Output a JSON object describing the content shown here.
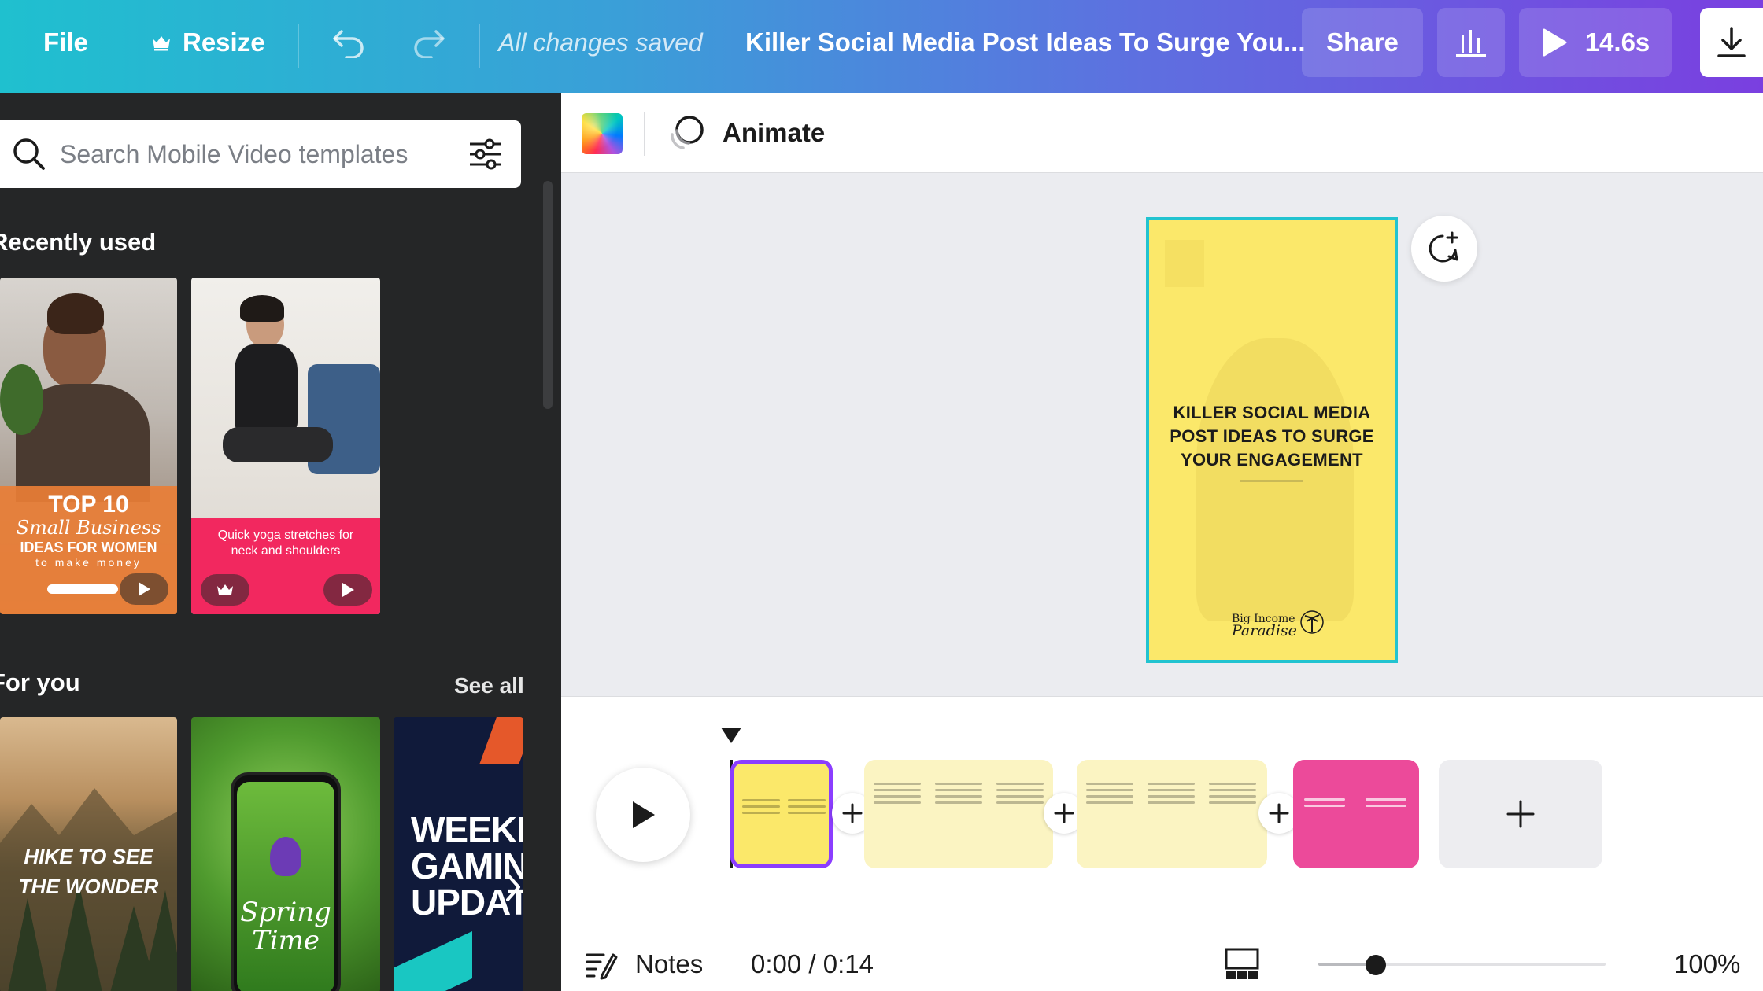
{
  "topbar": {
    "file_label": "File",
    "resize_label": "Resize",
    "saved_status": "All changes saved",
    "doc_title": "Killer Social Media Post Ideas To Surge You...",
    "share_label": "Share",
    "play_duration": "14.6s"
  },
  "sidebar": {
    "search_placeholder": "Search Mobile Video templates",
    "recently_used_title": "Recently used",
    "for_you_title": "For you",
    "see_all_label": "See all",
    "recent_templates": [
      {
        "line1": "TOP 10",
        "line2": "Small Business",
        "line3": "IDEAS FOR WOMEN",
        "line4": "to make money"
      },
      {
        "caption": "Quick yoga stretches for neck and shoulders"
      }
    ],
    "for_you_templates": [
      {
        "line1": "HIKE TO SEE",
        "line2": "THE WONDER"
      },
      {
        "line1": "Spring",
        "line2": "Time"
      },
      {
        "line1": "WEEKLY",
        "line2": "GAMING",
        "line3": "UPDATE"
      }
    ]
  },
  "editor": {
    "animate_label": "Animate",
    "page_title_text": "KILLER SOCIAL MEDIA POST IDEAS TO SURGE YOUR ENGAGEMENT",
    "brand_line1": "Big Income",
    "brand_line2": "Paradise"
  },
  "footer": {
    "notes_label": "Notes",
    "time_readout": "0:00 / 0:14",
    "zoom_percent": "100%",
    "zoom_value": 0.2
  },
  "colors": {
    "accent_teal": "#22c3d0",
    "selection_purple": "#8b3dff",
    "page_yellow": "#fbe86a",
    "clip_cream": "#fbf4c2",
    "clip_pink": "#ec4a9a",
    "sidebar_bg": "#252627"
  }
}
